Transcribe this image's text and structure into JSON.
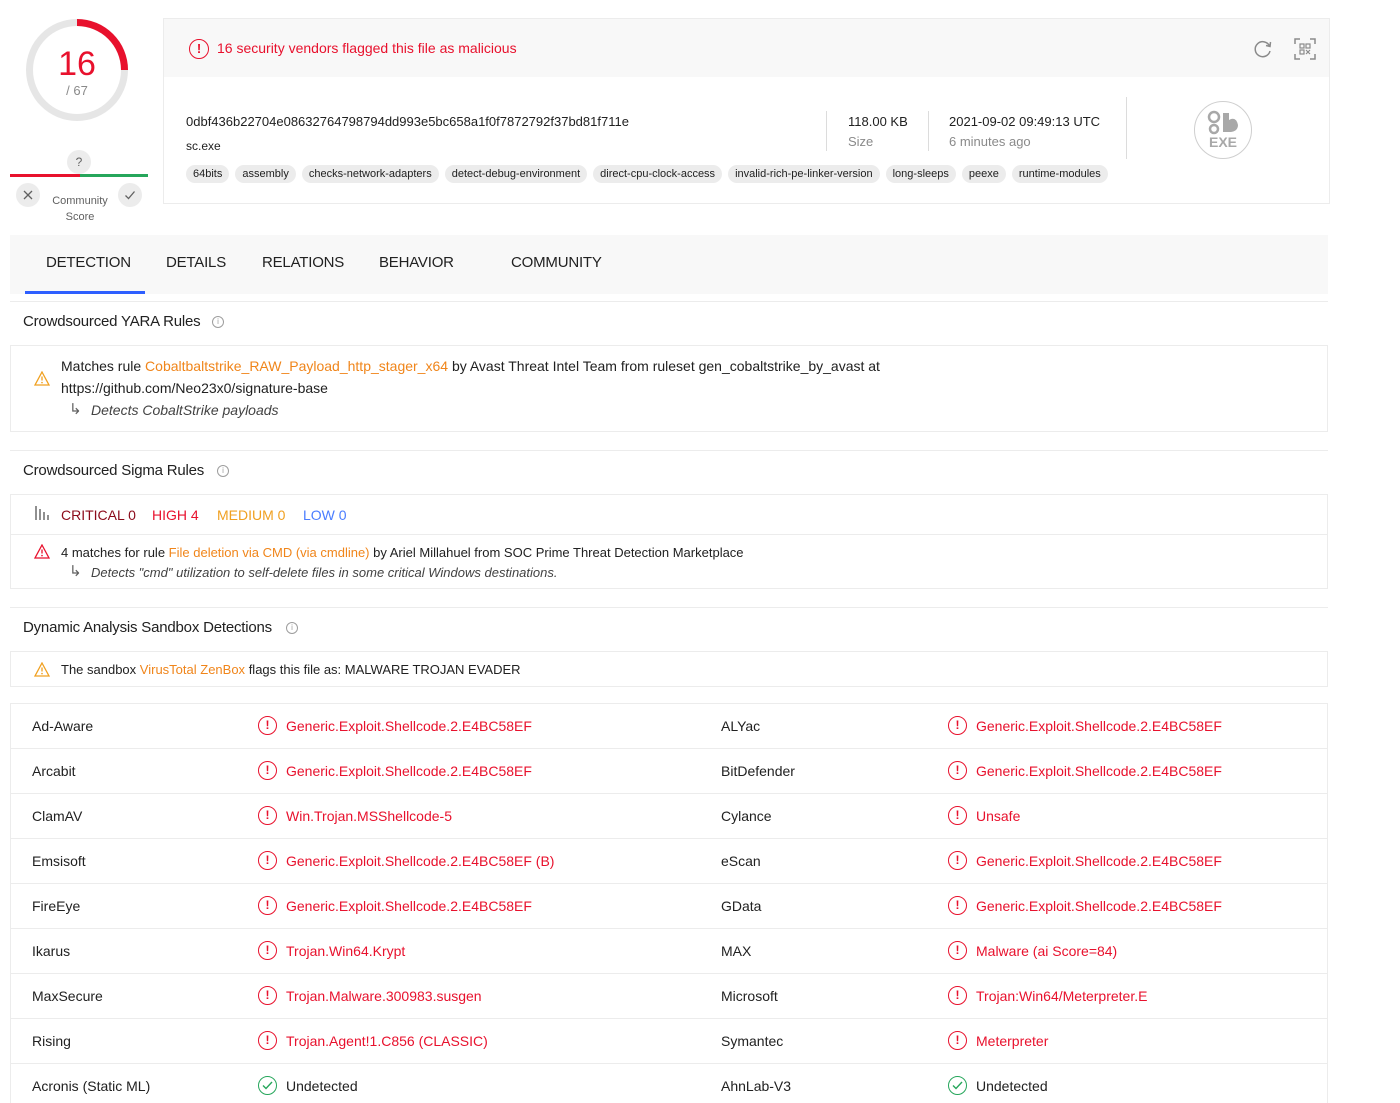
{
  "score": {
    "detections": "16",
    "total": "/ 67",
    "community_question": "?",
    "community_label_1": "Community",
    "community_label_2": "Score"
  },
  "summary": {
    "alert": "16 security vendors flagged this file as malicious",
    "hash": "0dbf436b22704e08632764798794dd993e5bc658a1f0f7872792f37bd81f711e",
    "filename": "sc.exe",
    "size_value": "118.00 KB",
    "size_label": "Size",
    "date_value": "2021-09-02 09:49:13 UTC",
    "date_ago": "6 minutes ago",
    "tags": [
      "64bits",
      "assembly",
      "checks-network-adapters",
      "detect-debug-environment",
      "direct-cpu-clock-access",
      "invalid-rich-pe-linker-version",
      "long-sleeps",
      "peexe",
      "runtime-modules"
    ],
    "filetype": "EXE"
  },
  "tabs": [
    "DETECTION",
    "DETAILS",
    "RELATIONS",
    "BEHAVIOR",
    "COMMUNITY"
  ],
  "yara": {
    "title": "Crowdsourced YARA Rules",
    "prefix": "Matches rule",
    "rule": "Cobaltbaltstrike_RAW_Payload_http_stager_x64",
    "middle": "by Avast Threat Intel Team from ruleset gen_cobaltstrike_by_avast at",
    "source": "https://github.com/Neo23x0/signature-base",
    "description": "Detects CobaltStrike payloads"
  },
  "sigma": {
    "title": "Crowdsourced Sigma Rules",
    "critical": "CRITICAL 0",
    "high": "HIGH 4",
    "medium": "MEDIUM 0",
    "low": "LOW 0",
    "prefix": "4 matches for rule",
    "rule": "File deletion via CMD (via cmdline)",
    "suffix": "by Ariel Millahuel from SOC Prime Threat Detection Marketplace",
    "description": "Detects \"cmd\" utilization to self-delete files in some critical Windows destinations."
  },
  "sandbox": {
    "title": "Dynamic Analysis Sandbox Detections",
    "prefix": "The sandbox",
    "name": "VirusTotal ZenBox",
    "suffix": "flags this file as: MALWARE TROJAN EVADER"
  },
  "vendors": [
    {
      "left_name": "Ad-Aware",
      "left_result": "Generic.Exploit.Shellcode.2.E4BC58EF",
      "left_status": "malicious",
      "right_name": "ALYac",
      "right_result": "Generic.Exploit.Shellcode.2.E4BC58EF",
      "right_status": "malicious"
    },
    {
      "left_name": "Arcabit",
      "left_result": "Generic.Exploit.Shellcode.2.E4BC58EF",
      "left_status": "malicious",
      "right_name": "BitDefender",
      "right_result": "Generic.Exploit.Shellcode.2.E4BC58EF",
      "right_status": "malicious"
    },
    {
      "left_name": "ClamAV",
      "left_result": "Win.Trojan.MSShellcode-5",
      "left_status": "malicious",
      "right_name": "Cylance",
      "right_result": "Unsafe",
      "right_status": "malicious"
    },
    {
      "left_name": "Emsisoft",
      "left_result": "Generic.Exploit.Shellcode.2.E4BC58EF (B)",
      "left_status": "malicious",
      "right_name": "eScan",
      "right_result": "Generic.Exploit.Shellcode.2.E4BC58EF",
      "right_status": "malicious"
    },
    {
      "left_name": "FireEye",
      "left_result": "Generic.Exploit.Shellcode.2.E4BC58EF",
      "left_status": "malicious",
      "right_name": "GData",
      "right_result": "Generic.Exploit.Shellcode.2.E4BC58EF",
      "right_status": "malicious"
    },
    {
      "left_name": "Ikarus",
      "left_result": "Trojan.Win64.Krypt",
      "left_status": "malicious",
      "right_name": "MAX",
      "right_result": "Malware (ai Score=84)",
      "right_status": "malicious"
    },
    {
      "left_name": "MaxSecure",
      "left_result": "Trojan.Malware.300983.susgen",
      "left_status": "malicious",
      "right_name": "Microsoft",
      "right_result": "Trojan:Win64/Meterpreter.E",
      "right_status": "malicious"
    },
    {
      "left_name": "Rising",
      "left_result": "Trojan.Agent!1.C856 (CLASSIC)",
      "left_status": "malicious",
      "right_name": "Symantec",
      "right_result": "Meterpreter",
      "right_status": "malicious"
    },
    {
      "left_name": "Acronis (Static ML)",
      "left_result": "Undetected",
      "left_status": "undetected",
      "right_name": "AhnLab-V3",
      "right_result": "Undetected",
      "right_status": "undetected"
    }
  ],
  "colors": {
    "malicious": "#e8112d",
    "clean": "#26a65b",
    "accent": "#2e5fff",
    "rule_link": "#f0851a"
  }
}
